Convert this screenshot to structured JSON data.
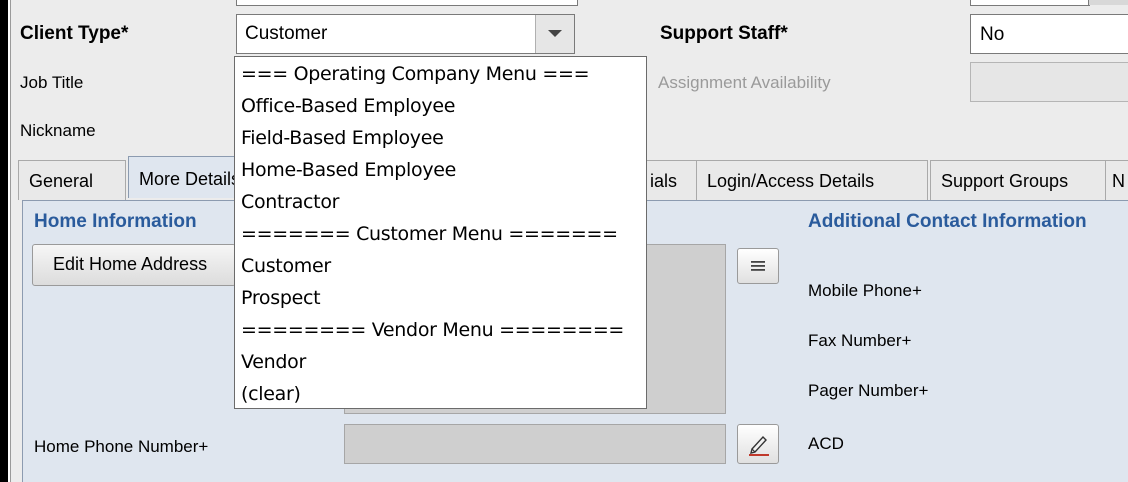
{
  "form": {
    "client_type_label": "Client Type*",
    "client_type_value": "Customer",
    "support_staff_label": "Support Staff*",
    "support_staff_value": "No",
    "job_title_label": "Job Title",
    "assignment_label": "Assignment Availability",
    "nickname_label": "Nickname"
  },
  "tabs": [
    {
      "label": "General"
    },
    {
      "label": "More Details"
    },
    {
      "label": "ials"
    },
    {
      "label": "Login/Access Details"
    },
    {
      "label": "Support Groups"
    },
    {
      "label": "N"
    }
  ],
  "panel": {
    "home_info_title": "Home Information",
    "edit_home_address": "Edit Home Address",
    "additional_title": "Additional Contact Information",
    "mobile_phone": "Mobile Phone+",
    "fax_number": "Fax Number+",
    "pager_number": "Pager Number+",
    "home_phone": "Home Phone Number+",
    "acd": "ACD"
  },
  "dropdown": {
    "options": [
      "=== Operating Company Menu ===",
      "Office-Based Employee",
      "Field-Based Employee",
      "Home-Based Employee",
      "Contractor",
      "======= Customer Menu =======",
      "Customer",
      "Prospect",
      "======== Vendor Menu ========",
      "Vendor",
      "(clear)"
    ]
  },
  "icons": {
    "dropdown_arrow": "chevron-down-icon",
    "list_button": "list-icon",
    "edit_button": "pencil-icon"
  }
}
